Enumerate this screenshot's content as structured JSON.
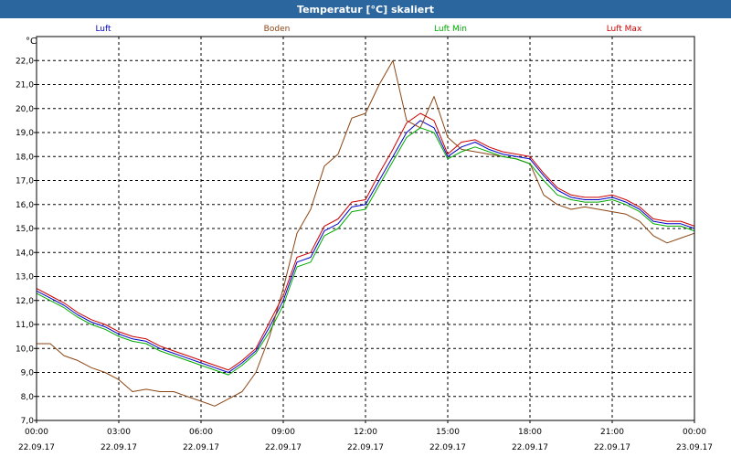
{
  "window": {
    "title": "Temperatur [°C] skaliert"
  },
  "chart_data": {
    "type": "line",
    "title": "Temperatur [°C] skaliert",
    "ylabel": "°C",
    "ylim": [
      7,
      23
    ],
    "y_ticks": [
      "7,0",
      "8,0",
      "9,0",
      "10,0",
      "11,0",
      "12,0",
      "13,0",
      "14,0",
      "15,0",
      "16,0",
      "17,0",
      "18,0",
      "19,0",
      "20,0",
      "21,0",
      "22,0"
    ],
    "x_ticks": [
      {
        "time": "00:00",
        "date": "22.09.17"
      },
      {
        "time": "03:00",
        "date": "22.09.17"
      },
      {
        "time": "06:00",
        "date": "22.09.17"
      },
      {
        "time": "09:00",
        "date": "22.09.17"
      },
      {
        "time": "12:00",
        "date": "22.09.17"
      },
      {
        "time": "15:00",
        "date": "22.09.17"
      },
      {
        "time": "18:00",
        "date": "22.09.17"
      },
      {
        "time": "21:00",
        "date": "22.09.17"
      },
      {
        "time": "00:00",
        "date": "23.09.17"
      }
    ],
    "grid": true,
    "legend": "top",
    "x_hours": [
      0,
      0.5,
      1,
      1.5,
      2,
      2.5,
      3,
      3.5,
      4,
      4.5,
      5,
      5.5,
      6,
      6.5,
      7,
      7.5,
      8,
      8.5,
      9,
      9.5,
      10,
      10.5,
      11,
      11.5,
      12,
      12.5,
      13,
      13.5,
      14,
      14.5,
      15,
      15.5,
      16,
      16.5,
      17,
      17.5,
      18,
      18.5,
      19,
      19.5,
      20,
      20.5,
      21,
      21.5,
      22,
      22.5,
      23,
      23.5,
      24
    ],
    "series": [
      {
        "name": "Luft",
        "color": "#0000cc",
        "values": [
          12.4,
          12.1,
          11.8,
          11.4,
          11.1,
          10.9,
          10.6,
          10.4,
          10.3,
          10.0,
          9.8,
          9.6,
          9.4,
          9.2,
          9.0,
          9.4,
          9.9,
          10.9,
          12.0,
          13.6,
          13.8,
          14.9,
          15.2,
          15.9,
          16.0,
          17.0,
          18.0,
          19.0,
          19.5,
          19.2,
          18.0,
          18.4,
          18.6,
          18.3,
          18.1,
          18.0,
          17.9,
          17.2,
          16.6,
          16.3,
          16.2,
          16.2,
          16.3,
          16.1,
          15.8,
          15.3,
          15.2,
          15.2,
          15.0
        ]
      },
      {
        "name": "Boden",
        "color": "#8b4513",
        "values": [
          10.2,
          10.2,
          9.7,
          9.5,
          9.2,
          9.0,
          8.7,
          8.2,
          8.3,
          8.2,
          8.2,
          8.0,
          7.8,
          7.6,
          7.9,
          8.2,
          9.0,
          10.5,
          12.5,
          14.8,
          15.8,
          17.6,
          18.1,
          19.6,
          19.8,
          21.0,
          22.0,
          19.5,
          19.2,
          20.5,
          18.8,
          18.3,
          18.2,
          18.1,
          18.0,
          17.9,
          17.7,
          16.4,
          16.0,
          15.8,
          15.9,
          15.8,
          15.7,
          15.6,
          15.3,
          14.7,
          14.4,
          14.6,
          14.8
        ]
      },
      {
        "name": "Luft Min",
        "color": "#00aa00",
        "values": [
          12.3,
          12.0,
          11.7,
          11.3,
          11.0,
          10.8,
          10.5,
          10.3,
          10.2,
          9.9,
          9.7,
          9.5,
          9.3,
          9.1,
          8.9,
          9.3,
          9.8,
          10.7,
          11.8,
          13.4,
          13.6,
          14.7,
          15.0,
          15.7,
          15.8,
          16.8,
          17.8,
          18.8,
          19.2,
          19.0,
          17.9,
          18.2,
          18.4,
          18.2,
          18.0,
          17.9,
          17.7,
          17.0,
          16.4,
          16.2,
          16.1,
          16.1,
          16.2,
          16.0,
          15.7,
          15.2,
          15.1,
          15.1,
          14.9
        ]
      },
      {
        "name": "Luft Max",
        "color": "#cc0000",
        "values": [
          12.5,
          12.2,
          11.9,
          11.5,
          11.2,
          11.0,
          10.7,
          10.5,
          10.4,
          10.1,
          9.9,
          9.7,
          9.5,
          9.3,
          9.1,
          9.5,
          10.0,
          11.1,
          12.2,
          13.8,
          14.0,
          15.1,
          15.4,
          16.1,
          16.2,
          17.3,
          18.3,
          19.4,
          19.8,
          19.5,
          18.1,
          18.6,
          18.7,
          18.4,
          18.2,
          18.1,
          18.0,
          17.3,
          16.7,
          16.4,
          16.3,
          16.3,
          16.4,
          16.2,
          15.9,
          15.4,
          15.3,
          15.3,
          15.1
        ]
      }
    ]
  }
}
